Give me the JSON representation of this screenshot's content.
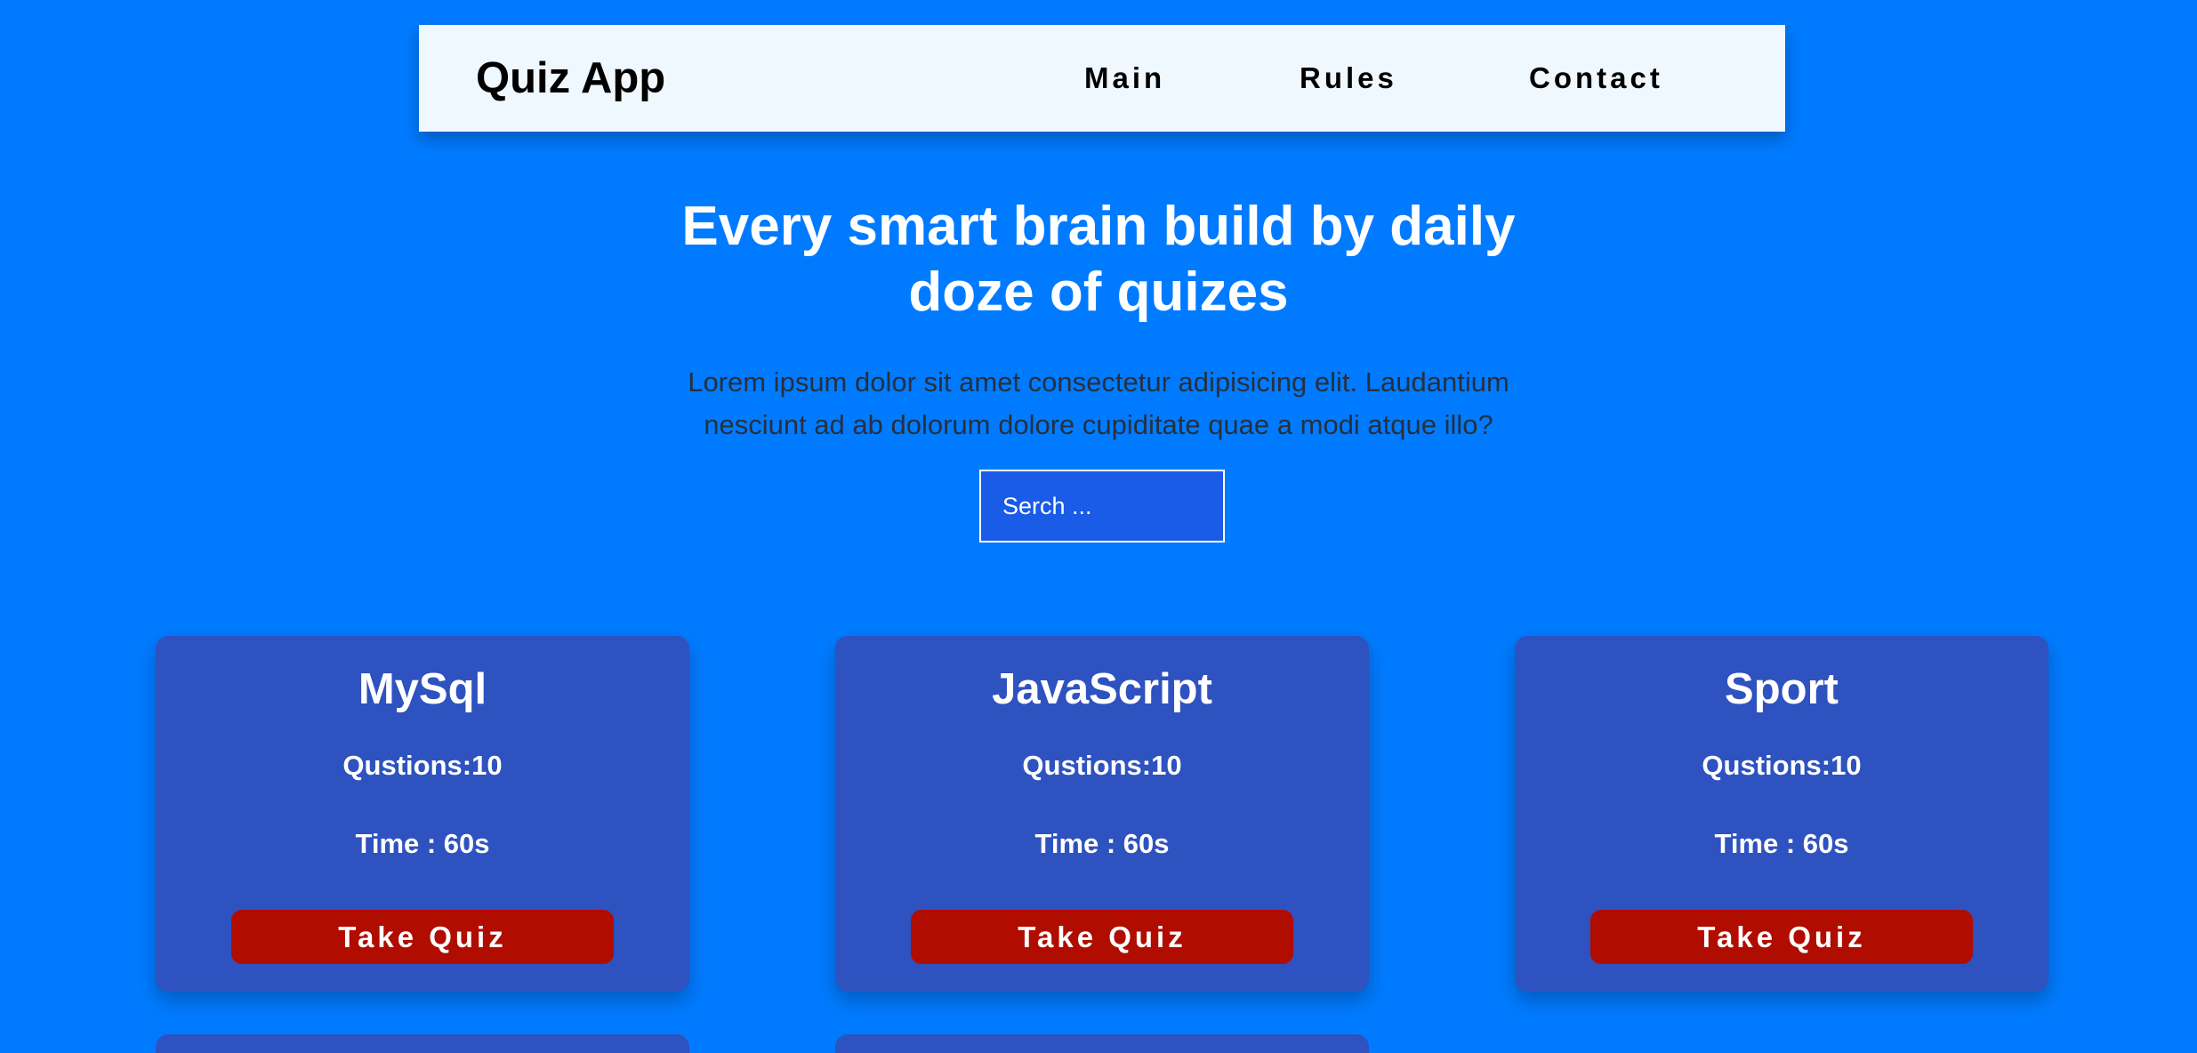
{
  "navbar": {
    "brand": "Quiz App",
    "links": [
      "Main",
      "Rules",
      "Contact"
    ]
  },
  "hero": {
    "title": "Every smart brain build by daily doze of quizes",
    "text": "Lorem ipsum dolor sit amet consectetur adipisicing elit. Laudantium nesciunt ad ab dolorum dolore cupiditate quae a modi atque illo?"
  },
  "search": {
    "placeholder": "Serch ..."
  },
  "cards": [
    {
      "title": "MySql",
      "questions": "Qustions:10",
      "time": "Time : 60s",
      "button": "Take Quiz"
    },
    {
      "title": "JavaScript",
      "questions": "Qustions:10",
      "time": "Time : 60s",
      "button": "Take Quiz"
    },
    {
      "title": "Sport",
      "questions": "Qustions:10",
      "time": "Time : 60s",
      "button": "Take Quiz"
    }
  ],
  "colors": {
    "background": "#007bff",
    "navbar": "#f0f8ff",
    "card": "#2e52bf",
    "button": "#b00c00",
    "search": "#1a5be8"
  }
}
